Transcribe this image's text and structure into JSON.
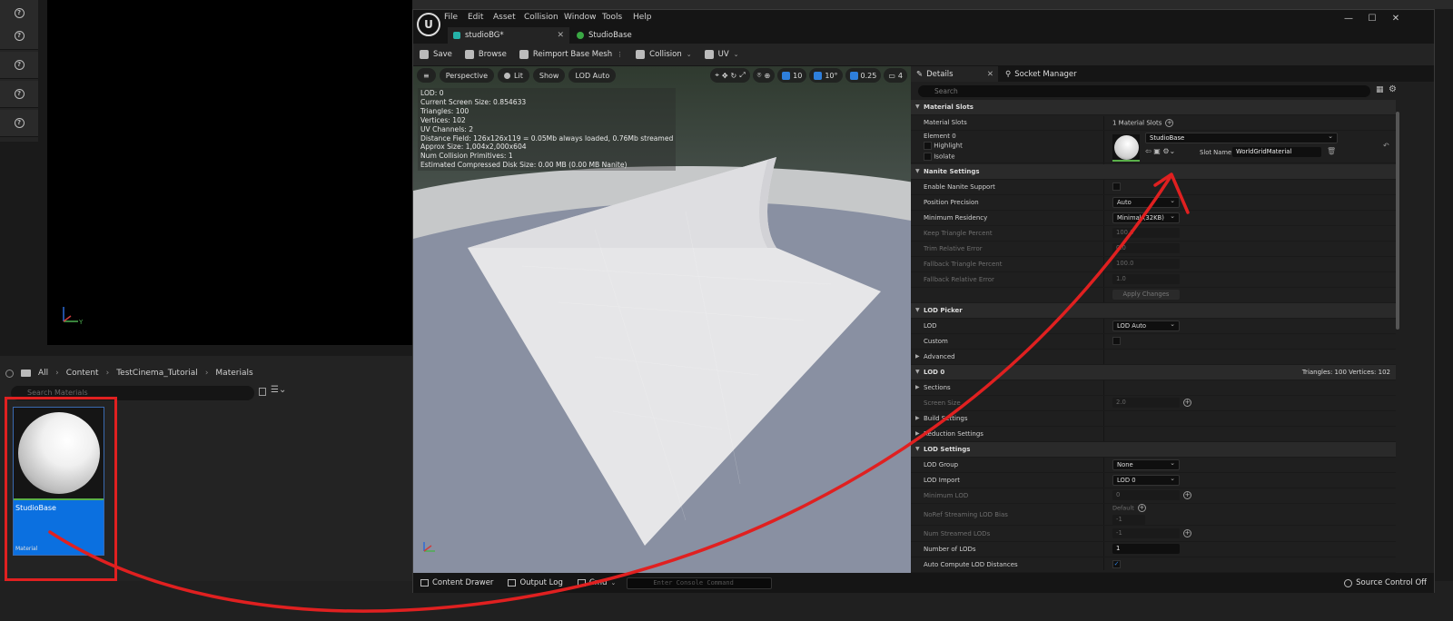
{
  "background": {
    "breadcrumb": [
      "All",
      "Content",
      "TestCinema_Tutorial",
      "Materials"
    ],
    "search_placeholder": "Search Materials",
    "asset": {
      "name": "StudioBase",
      "type": "Material"
    }
  },
  "window": {
    "menus": [
      "File",
      "Edit",
      "Asset",
      "Collision",
      "Window",
      "Tools",
      "Help"
    ],
    "tabs": [
      {
        "label": "studioBG*"
      },
      {
        "label": "StudioBase"
      }
    ],
    "toolbar": {
      "save": "Save",
      "browse": "Browse",
      "reimport": "Reimport Base Mesh",
      "collision": "Collision",
      "uv": "UV"
    },
    "viewport": {
      "perspective": "Perspective",
      "lit": "Lit",
      "show": "Show",
      "lod": "LOD Auto",
      "grid_value": "10",
      "angle_value": "10°",
      "scale_value": "0.25",
      "camera_speed": "4",
      "stats": [
        "LOD:  0",
        "Current Screen Size:  0.854633",
        "Triangles:  100",
        "Vertices:  102",
        "UV Channels:  2",
        "Distance Field:  126x126x119 = 0.05Mb always loaded, 0.76Mb streamed",
        "Approx Size: 1,004x2,000x604",
        "Num Collision Primitives:  1",
        "Estimated Compressed Disk Size: 0.00 MB (0.00 MB Nanite)"
      ]
    },
    "details": {
      "tab_details": "Details",
      "tab_socket": "Socket Manager",
      "search_placeholder": "Search",
      "material_slots_header": "Material Slots",
      "material_slots_label": "Material Slots",
      "material_slots_value": "1 Material Slots",
      "element_label": "Element 0",
      "highlight": "Highlight",
      "isolate": "Isolate",
      "material_name": "StudioBase",
      "slot_name_label": "Slot Name",
      "slot_name_value": "WorldGridMaterial",
      "nanite_header": "Nanite Settings",
      "enable_nanite": "Enable Nanite Support",
      "position_precision": "Position Precision",
      "position_precision_value": "Auto",
      "minimum_residency": "Minimum Residency",
      "minimum_residency_value": "Minimal (32KB)",
      "keep_triangle": "Keep Triangle Percent",
      "keep_triangle_value": "100.0",
      "trim_error": "Trim Relative Error",
      "trim_error_value": "0.0",
      "fallback_triangle": "Fallback Triangle Percent",
      "fallback_triangle_value": "100.0",
      "fallback_error": "Fallback Relative Error",
      "fallback_error_value": "1.0",
      "apply_changes": "Apply Changes",
      "lod_picker_header": "LOD Picker",
      "lod_label": "LOD",
      "lod_value": "LOD Auto",
      "custom_label": "Custom",
      "advanced_label": "Advanced",
      "lod0_header": "LOD 0",
      "lod0_stats": "Triangles: 100     Vertices: 102",
      "sections": "Sections",
      "screen_size": "Screen Size",
      "screen_size_value": "2.0",
      "build_settings": "Build Settings",
      "reduction_settings": "Reduction Settings",
      "lod_settings_header": "LOD Settings",
      "lod_group": "LOD Group",
      "lod_group_value": "None",
      "lod_import": "LOD Import",
      "lod_import_value": "LOD 0",
      "minimum_lod": "Minimum LOD",
      "minimum_lod_value": "0",
      "noref_streaming": "NoRef Streaming LOD Bias",
      "noref_default": "Default",
      "noref_value": "-1",
      "num_streamed": "Num Streamed LODs",
      "num_streamed_value": "-1",
      "number_of_lods": "Number of LODs",
      "number_of_lods_value": "1",
      "auto_compute": "Auto Compute LOD Distances"
    },
    "statusbar": {
      "content_drawer": "Content Drawer",
      "output_log": "Output Log",
      "cmd": "Cmd",
      "console_placeholder": "Enter Console Command",
      "source_control": "Source Control Off"
    }
  },
  "colors": {
    "selection_blue": "#0b70e0",
    "annotation_red": "#e02020",
    "accent_green": "#5ab04a"
  }
}
